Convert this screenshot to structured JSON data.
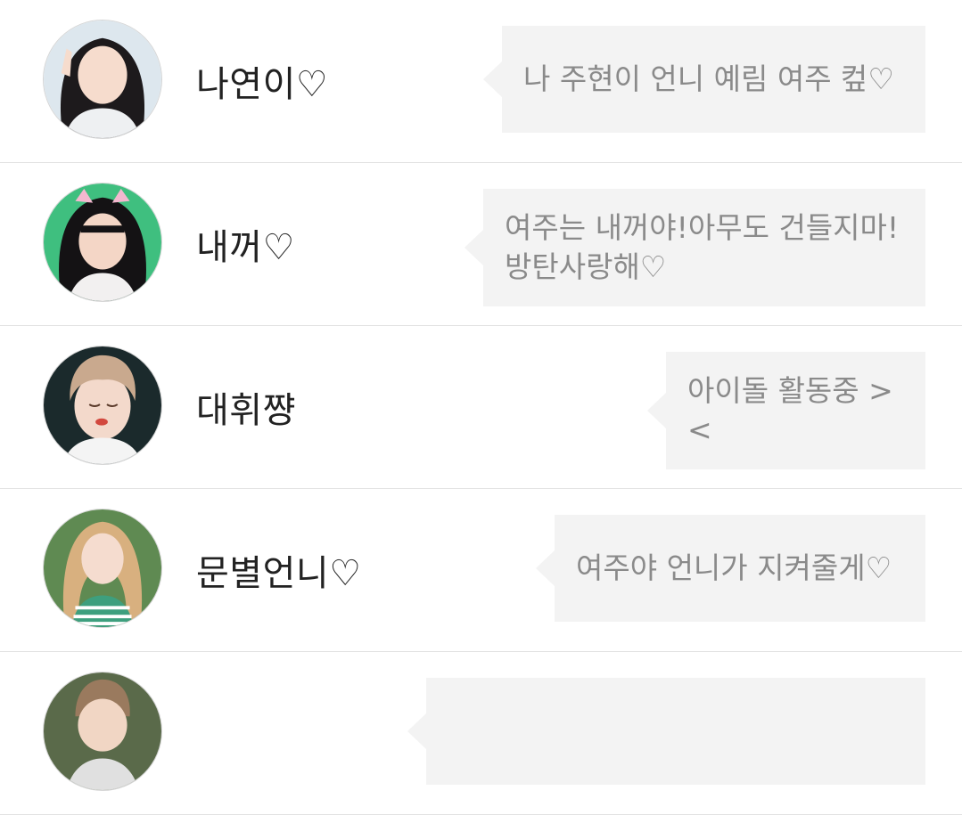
{
  "friends": [
    {
      "name": "나연이♡",
      "status": "나 주현이 언니 예림 여주 컾♡",
      "avatar_bg": "#dde7ee",
      "avatar_hair": "#1d1a1c",
      "avatar_shirt": "#eef0f2"
    },
    {
      "name": "내꺼♡",
      "status": "여주는 내꺼야!아무도 건들지마!\n방탄사랑해♡",
      "avatar_bg": "#3fbf7f",
      "avatar_hair": "#141214",
      "avatar_shirt": "#f2f0f0"
    },
    {
      "name": "대휘쨩",
      "status": "아이돌 활동중 ><",
      "avatar_bg": "#1b2a2c",
      "avatar_hair": "#c9a98e",
      "avatar_shirt": "#f4f4f4"
    },
    {
      "name": "문별언니♡",
      "status": "여주야 언니가 지켜줄게♡",
      "avatar_bg": "#5f8a52",
      "avatar_hair": "#d8b07f",
      "avatar_shirt": "#3e9f7e"
    },
    {
      "name": "",
      "status": "",
      "avatar_bg": "#5a6a4a",
      "avatar_hair": "#9a7a5e",
      "avatar_shirt": "#e0e0e0"
    }
  ],
  "colors": {
    "bubble_bg": "#f3f3f3",
    "message_text": "#8a8a8a",
    "name_text": "#222222",
    "divider": "#e2e2e2"
  }
}
